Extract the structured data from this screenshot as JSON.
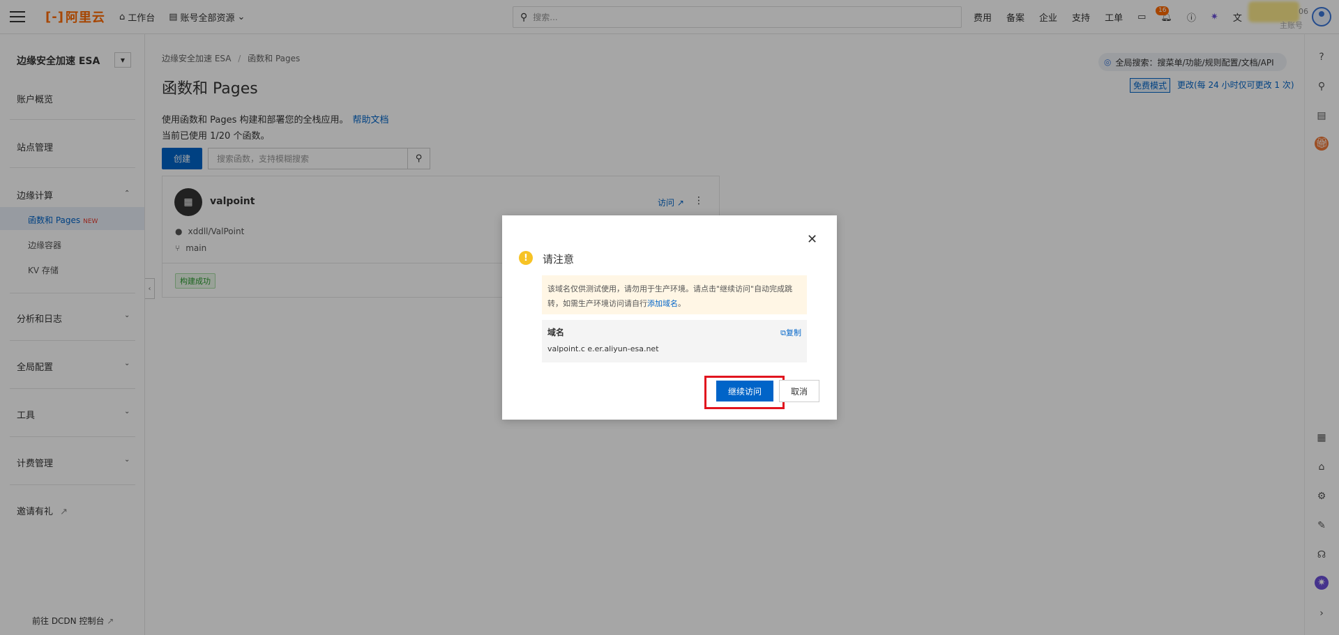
{
  "topbar": {
    "logo_text": "阿里云",
    "workbench": "工作台",
    "resources": "账号全部资源",
    "search_placeholder": "搜索...",
    "links": [
      "费用",
      "备案",
      "企业",
      "支持",
      "工单"
    ],
    "notification_count": "16",
    "account_sub": "主账号",
    "account_num": "06"
  },
  "sidebar": {
    "title": "边缘安全加速 ESA",
    "items": {
      "account_overview": "账户概览",
      "site_management": "站点管理",
      "edge_computing": "边缘计算",
      "functions_pages": "函数和 Pages",
      "new_tag": "NEW",
      "edge_container": "边缘容器",
      "kv_storage": "KV 存储",
      "analytics_logs": "分析和日志",
      "global_config": "全局配置",
      "tools": "工具",
      "billing": "计费管理",
      "invite": "邀请有礼"
    },
    "bottom_link": "前往 DCDN 控制台"
  },
  "main": {
    "breadcrumb": [
      "边缘安全加速 ESA",
      "函数和 Pages"
    ],
    "title": "函数和 Pages",
    "desc": "使用函数和 Pages 构建和部署您的全栈应用。",
    "help_link": "帮助文档",
    "usage": "当前已使用 1/20 个函数。",
    "create_label": "创建",
    "search_placeholder": "搜索函数，支持模糊搜索",
    "global_search": "全局搜索：搜菜单/功能/规则配置/文档/API",
    "free_mode": "免费模式",
    "change_mode": "更改(每 24 小时仅可更改 1 次)"
  },
  "card": {
    "name": "valpoint",
    "visit": "访问",
    "repo": "xddll/ValPoint",
    "branch": "main",
    "status": "构建成功"
  },
  "modal": {
    "title": "请注意",
    "notice_text": "该域名仅供测试使用，请勿用于生产环境。请点击\"继续访问\"自动完成跳转，如需生产环境访问请自行",
    "notice_link": "添加域名",
    "notice_end": "。",
    "domain_label": "域名",
    "domain_value": "valpoint.c        e.er.aliyun-esa.net",
    "copy_label": "复制",
    "continue_label": "继续访问",
    "cancel_label": "取消"
  },
  "colors": {
    "brand": "#ff6a00",
    "primary": "#0064c8",
    "highlight": "#e1141e",
    "success": "#2a9a2f"
  }
}
